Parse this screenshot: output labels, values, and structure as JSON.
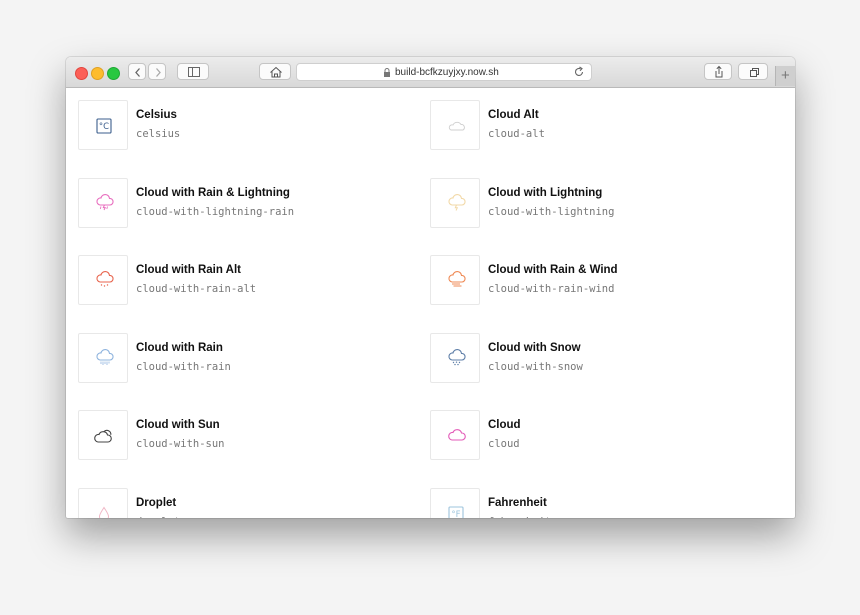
{
  "browser": {
    "url": "build-bcfkzuyjxy.now.sh",
    "new_tab_label": "+"
  },
  "icons": [
    {
      "title": "Celsius",
      "slug": "celsius",
      "icon": "celsius-icon",
      "color": "#3b5e8c",
      "symbol": "°C"
    },
    {
      "title": "Cloud Alt",
      "slug": "cloud-alt",
      "icon": "cloud-alt-icon",
      "color": "#cfcfcf"
    },
    {
      "title": "Cloud with Rain & Lightning",
      "slug": "cloud-with-lightning-rain",
      "icon": "cloud-lightning-rain-icon",
      "color": "#e86fbf"
    },
    {
      "title": "Cloud with Lightning",
      "slug": "cloud-with-lightning",
      "icon": "cloud-lightning-icon",
      "color": "#f2d9a8"
    },
    {
      "title": "Cloud with Rain Alt",
      "slug": "cloud-with-rain-alt",
      "icon": "cloud-rain-alt-icon",
      "color": "#e8664f"
    },
    {
      "title": "Cloud with Rain & Wind",
      "slug": "cloud-with-rain-wind",
      "icon": "cloud-rain-wind-icon",
      "color": "#ef8a55"
    },
    {
      "title": "Cloud with Rain",
      "slug": "cloud-with-rain",
      "icon": "cloud-rain-icon",
      "color": "#8fb4de"
    },
    {
      "title": "Cloud with Snow",
      "slug": "cloud-with-snow",
      "icon": "cloud-snow-icon",
      "color": "#5f7fa8"
    },
    {
      "title": "Cloud with Sun",
      "slug": "cloud-with-sun",
      "icon": "cloud-sun-icon",
      "color": "#444444"
    },
    {
      "title": "Cloud",
      "slug": "cloud",
      "icon": "cloud-icon",
      "color": "#e35bb8"
    },
    {
      "title": "Droplet",
      "slug": "droplet",
      "icon": "droplet-icon",
      "color": "#f0b8c6"
    },
    {
      "title": "Fahrenheit",
      "slug": "fahrenheit",
      "icon": "fahrenheit-icon",
      "color": "#9dc4dc",
      "symbol": "°F"
    }
  ]
}
